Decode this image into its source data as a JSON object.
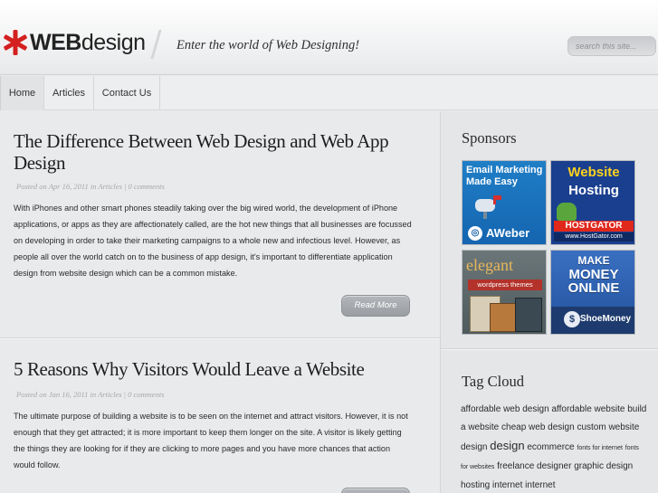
{
  "header": {
    "logo_bold": "WEB",
    "logo_light": "design",
    "tagline": "Enter the world of Web Designing!",
    "search_placeholder": "search this site..."
  },
  "nav": {
    "items": [
      {
        "label": "Home"
      },
      {
        "label": "Articles"
      },
      {
        "label": "Contact Us"
      }
    ]
  },
  "posts": [
    {
      "title_line1": "The Difference Between Web Design and Web App",
      "title_line2": "Design",
      "meta": "Posted on Apr 16, 2011 in Articles | 0 comments",
      "body": "With iPhones and other smart phones steadily taking over the big wired world, the development of iPhone applications, or apps as they are affectionately called, are the hot new things that all businesses are focussed on developing in order to take their marketing campaigns to a whole new and infectious level. However, as people all over the world catch on to the business of app design, it's important to differentiate application design from website design which can be a common mistake.",
      "read_more": "Read More"
    },
    {
      "title_line1": "5 Reasons Why Visitors Would Leave a Website",
      "meta": "Posted on Jan 16, 2011 in Articles | 0 comments",
      "body": "The ultimate purpose of building a website is to be seen on the internet and attract visitors. However, it is not enough that they get attracted; it is more important to keep them longer on the site. A visitor is likely getting the things they are looking for if they are clicking to more pages and you have more chances that action would follow."
    }
  ],
  "sidebar": {
    "sponsors_heading": "Sponsors",
    "ads": [
      {
        "line1": "Email Marketing",
        "line2": "Made Easy",
        "brand": "AWeber",
        "color": "#2a86c8"
      },
      {
        "line1": "Website",
        "line2": "Hosting",
        "brand": "HOSTGATOR",
        "brand_sub": "www.HostGator.com",
        "color": "#1a3f8f"
      },
      {
        "line1": "elegant",
        "line2": "wordpress themes",
        "color": "#5d6a6e"
      },
      {
        "line1": "MAKE",
        "line2": "MONEY",
        "line3": "ONLINE",
        "brand": "ShoeMoney",
        "color": "#2c5fae"
      }
    ],
    "tag_heading": "Tag Cloud",
    "tags": [
      {
        "text": "affordable web design",
        "size": "s2"
      },
      {
        "text": "affordable website",
        "size": "s2"
      },
      {
        "text": "build a website",
        "size": "s2"
      },
      {
        "text": "cheap web design",
        "size": "s2"
      },
      {
        "text": "custom website design",
        "size": "s2"
      },
      {
        "text": "design",
        "size": "s3"
      },
      {
        "text": "ecommerce",
        "size": "s2"
      },
      {
        "text": "fonts for internet",
        "size": "s1"
      },
      {
        "text": "fonts for websites",
        "size": "s1"
      },
      {
        "text": "freelance designer",
        "size": "s2"
      },
      {
        "text": "graphic design",
        "size": "s2"
      },
      {
        "text": "hosting",
        "size": "s2"
      },
      {
        "text": "internet",
        "size": "s2"
      },
      {
        "text": "internet",
        "size": "s2"
      }
    ]
  },
  "colors": {
    "logo_star": "#d42020",
    "accent_button": "#a4a8ad"
  }
}
